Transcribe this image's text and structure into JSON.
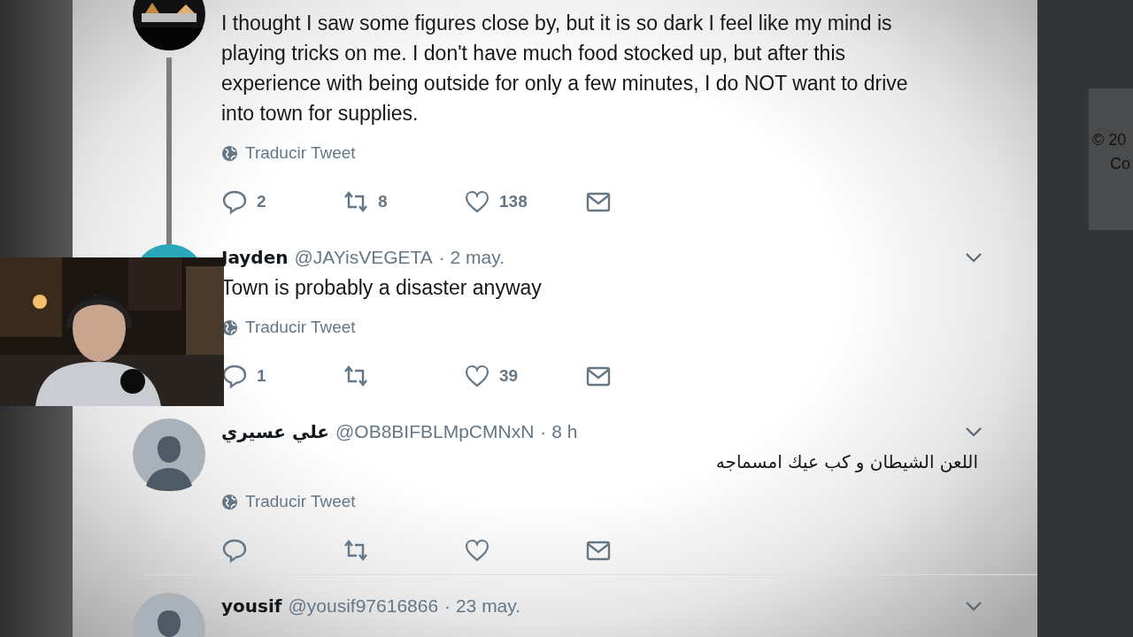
{
  "tweets": [
    {
      "avatar": {
        "kind": "picture",
        "covered": false
      },
      "thread_line": true,
      "body": "I thought I saw some figures close by, but it is so dark I feel like my mind is playing tricks on me. I don't have much food stocked up, but after this experience with being outside for only a few minutes, I do NOT want to drive into town for supplies.",
      "kind": "ltr",
      "translate": "Traducir Tweet",
      "actions": [
        {
          "kind": "reply",
          "count": "2"
        },
        {
          "kind": "retweet",
          "count": "8"
        },
        {
          "kind": "like",
          "count": "138"
        },
        {
          "kind": "mail"
        }
      ],
      "divider_below": false
    },
    {
      "avatar": {
        "kind": "picture",
        "covered": true
      },
      "thread_line": false,
      "name": "Jayden",
      "handle": "@JAYisVEGETA",
      "date": "· 2 may.",
      "menu": true,
      "body": "Town is probably a disaster anyway",
      "kind": "ltr",
      "translate": "Traducir Tweet",
      "actions": [
        {
          "kind": "reply",
          "count": "1"
        },
        {
          "kind": "retweet"
        },
        {
          "kind": "like",
          "count": "39"
        },
        {
          "kind": "mail"
        }
      ],
      "divider_below": false
    },
    {
      "avatar": {
        "kind": "default"
      },
      "thread_line": false,
      "name": "علي عسيري",
      "handle": "@OB8BIFBLMpCMNxN",
      "date": "· 8 h",
      "menu": true,
      "body": "اللعن الشيطان و كب عيك امسماجه",
      "kind": "rtl",
      "translate": "Traducir Tweet",
      "actions": [
        {
          "kind": "reply"
        },
        {
          "kind": "retweet"
        },
        {
          "kind": "like"
        },
        {
          "kind": "mail"
        }
      ],
      "divider_below": true
    },
    {
      "avatar": {
        "kind": "default"
      },
      "thread_line": false,
      "name": "yousif",
      "handle": "@yousif97616866",
      "date": "· 23 may.",
      "menu": true,
      "divider_below": false
    }
  ],
  "sidebar": {
    "copyright": "© 20",
    "line_2": "Co"
  },
  "webcam": {
    "kind": "picture"
  }
}
